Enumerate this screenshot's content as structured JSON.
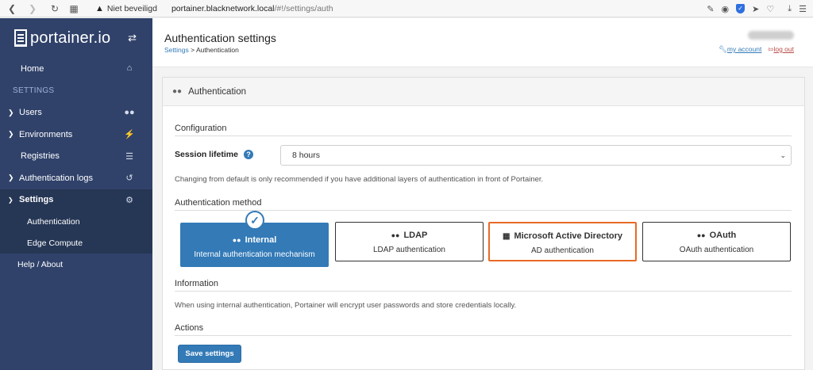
{
  "browser": {
    "security_label": "Niet beveiligd",
    "url_host": "portainer.blacknetwork.local",
    "url_path": "/#!/settings/auth"
  },
  "sidebar": {
    "brand": "portainer.io",
    "items": [
      {
        "label": "Home"
      },
      {
        "label": "SETTINGS"
      },
      {
        "label": "Users"
      },
      {
        "label": "Environments"
      },
      {
        "label": "Registries"
      },
      {
        "label": "Authentication logs"
      },
      {
        "label": "Settings"
      },
      {
        "label": "Authentication"
      },
      {
        "label": "Edge Compute"
      },
      {
        "label": "Help / About"
      }
    ]
  },
  "header": {
    "title": "Authentication settings",
    "breadcrumb_link": "Settings",
    "breadcrumb_rest": "> Authentication",
    "my_account": "my account",
    "log_out": "log out"
  },
  "panel": {
    "title": "Authentication",
    "configuration": "Configuration",
    "session_label": "Session lifetime",
    "session_value": "8 hours",
    "session_help": "Changing from default is only recommended if you have additional layers of authentication in front of Portainer.",
    "auth_method": "Authentication method",
    "methods": [
      {
        "title": "Internal",
        "desc": "Internal authentication mechanism"
      },
      {
        "title": "LDAP",
        "desc": "LDAP authentication"
      },
      {
        "title": "Microsoft Active Directory",
        "desc": "AD authentication"
      },
      {
        "title": "OAuth",
        "desc": "OAuth authentication"
      }
    ],
    "information": "Information",
    "info_text": "When using internal authentication, Portainer will encrypt user passwords and store credentials locally.",
    "actions": "Actions",
    "save": "Save settings"
  },
  "colors": {
    "sidebar_bg": "#30426a",
    "primary": "#337ab7",
    "hover_border": "#e86a25"
  }
}
